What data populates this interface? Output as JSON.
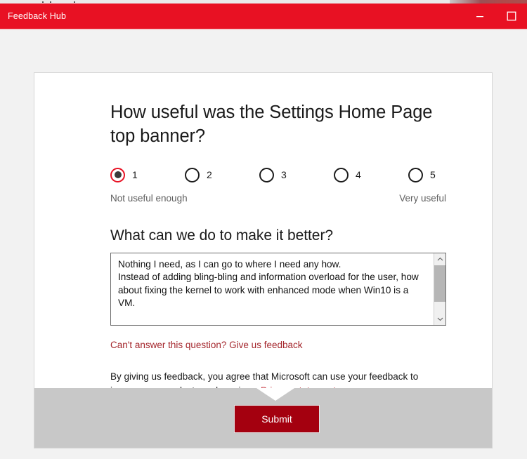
{
  "window": {
    "title": "Feedback Hub",
    "accent_color": "#e81123",
    "controls": [
      {
        "name": "minimize",
        "glyph": "minimize-icon"
      },
      {
        "name": "maximize",
        "glyph": "maximize-icon"
      }
    ]
  },
  "survey": {
    "question": "How useful was the Settings Home Page top banner?",
    "rating": {
      "options": [
        {
          "value": "1",
          "selected": true
        },
        {
          "value": "2",
          "selected": false
        },
        {
          "value": "3",
          "selected": false
        },
        {
          "value": "4",
          "selected": false
        },
        {
          "value": "5",
          "selected": false
        }
      ],
      "low_label": "Not useful enough",
      "high_label": "Very useful",
      "selected_value": "1"
    },
    "subquestion": "What can we do to make it better?",
    "answer": {
      "value": "Nothing I need, as I can go to where I need any how.\nInstead of adding bling-bling and information overload for the user, how\nabout fixing the kernel to work with enhanced mode when Win10 is a\nVM.",
      "placeholder": ""
    },
    "cant_answer_link": "Can't answer this question? Give us feedback",
    "consent_text": "By giving us feedback, you agree that Microsoft can use your feedback to improve our products and services. ",
    "privacy_link": "Privacy statement",
    "submit_label": "Submit",
    "link_color": "#a4262c",
    "submit_color": "#a4000f"
  }
}
